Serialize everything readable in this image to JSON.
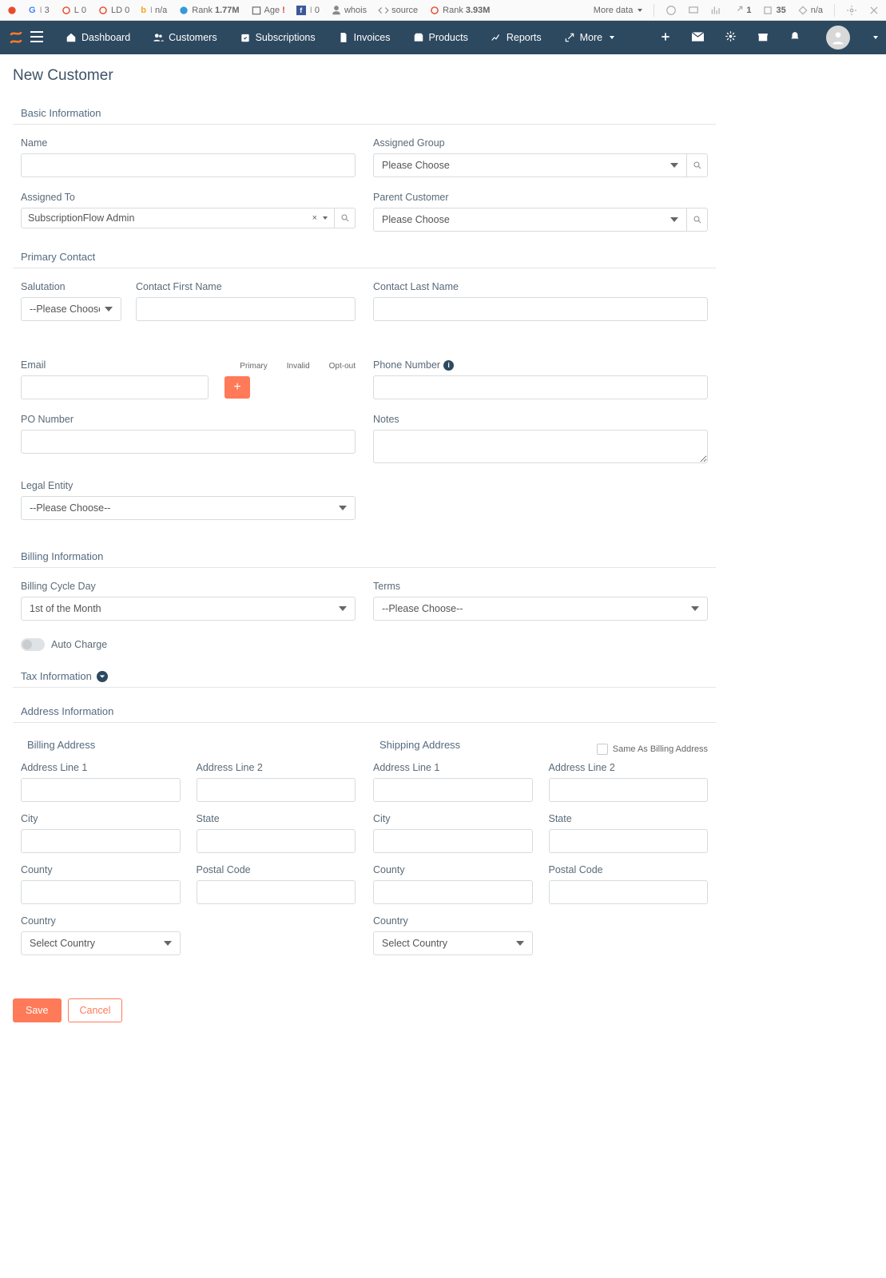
{
  "ext": {
    "items": [
      "3",
      "0",
      "0",
      "n/a",
      "1.77M",
      "Age",
      "0",
      "whois",
      "source",
      "3.93M"
    ],
    "labels": {
      "g": "G",
      "i": "I",
      "l": "L",
      "ld": "LD",
      "b": "b",
      "rank": "Rank",
      "age": "Age",
      "fb": "f",
      "i2": "I",
      "whois": "whois",
      "src": "source",
      "rank2": "Rank"
    },
    "more": "More data",
    "right": [
      "1",
      "35",
      "n/a"
    ]
  },
  "nav": {
    "links": [
      "Dashboard",
      "Customers",
      "Subscriptions",
      "Invoices",
      "Products",
      "Reports",
      "More"
    ]
  },
  "page_title": "New Customer",
  "sections": {
    "basic": "Basic Information",
    "primary": "Primary Contact",
    "billing": "Billing Information",
    "tax": "Tax Information",
    "address": "Address Information"
  },
  "fields": {
    "name": "Name",
    "assigned_group": "Assigned Group",
    "assigned_to": "Assigned To",
    "assigned_to_value": "SubscriptionFlow Admin",
    "parent_customer": "Parent Customer",
    "please_choose": "Please Choose",
    "please_choose_dash": "--Please Choose--",
    "salutation": "Salutation",
    "first_name": "Contact First Name",
    "last_name": "Contact Last Name",
    "email": "Email",
    "phone": "Phone Number",
    "po": "PO Number",
    "notes": "Notes",
    "legal": "Legal Entity",
    "bcd": "Billing Cycle Day",
    "bcd_value": "1st of the Month",
    "terms": "Terms",
    "auto": "Auto Charge",
    "chk": {
      "primary": "Primary",
      "invalid": "Invalid",
      "optout": "Opt-out"
    }
  },
  "address": {
    "billing": "Billing Address",
    "shipping": "Shipping Address",
    "same": "Same As Billing Address",
    "line1": "Address Line 1",
    "line2": "Address Line 2",
    "city": "City",
    "state": "State",
    "county": "County",
    "postal": "Postal Code",
    "country": "Country",
    "select_country": "Select Country"
  },
  "actions": {
    "save": "Save",
    "cancel": "Cancel"
  }
}
